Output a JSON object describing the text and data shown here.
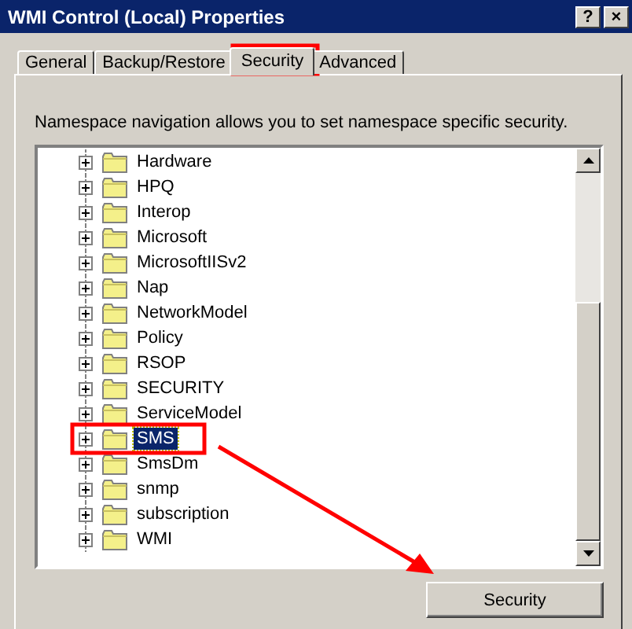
{
  "window": {
    "title": "WMI Control (Local) Properties",
    "buttons": [
      "?",
      "×"
    ]
  },
  "tabs": [
    {
      "label": "General",
      "selected": false
    },
    {
      "label": "Backup/Restore",
      "selected": false
    },
    {
      "label": "Security",
      "selected": true
    },
    {
      "label": "Advanced",
      "selected": false
    }
  ],
  "description": "Namespace navigation allows you to set namespace specific security.",
  "tree": {
    "items": [
      {
        "label": "Hardware",
        "expanded": false,
        "selected": false
      },
      {
        "label": "HPQ",
        "expanded": false,
        "selected": false
      },
      {
        "label": "Interop",
        "expanded": false,
        "selected": false
      },
      {
        "label": "Microsoft",
        "expanded": false,
        "selected": false
      },
      {
        "label": "MicrosoftIISv2",
        "expanded": false,
        "selected": false
      },
      {
        "label": "Nap",
        "expanded": false,
        "selected": false
      },
      {
        "label": "NetworkModel",
        "expanded": false,
        "selected": false
      },
      {
        "label": "Policy",
        "expanded": false,
        "selected": false
      },
      {
        "label": "RSOP",
        "expanded": false,
        "selected": false
      },
      {
        "label": "SECURITY",
        "expanded": false,
        "selected": false
      },
      {
        "label": "ServiceModel",
        "expanded": false,
        "selected": false
      },
      {
        "label": "SMS",
        "expanded": false,
        "selected": true
      },
      {
        "label": "SmsDm",
        "expanded": false,
        "selected": false
      },
      {
        "label": "snmp",
        "expanded": false,
        "selected": false
      },
      {
        "label": "subscription",
        "expanded": false,
        "selected": false
      },
      {
        "label": "WMI",
        "expanded": false,
        "selected": false
      }
    ]
  },
  "buttons": [
    "Security"
  ]
}
